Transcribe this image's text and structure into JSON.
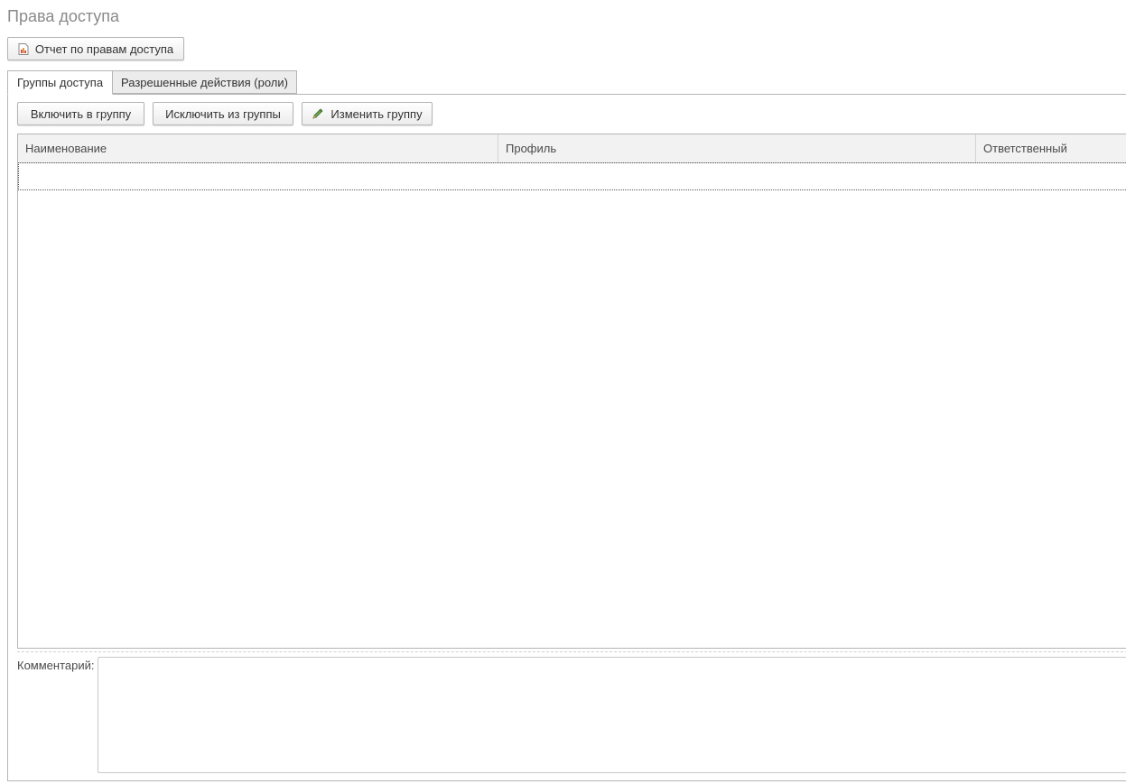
{
  "page": {
    "title": "Права доступа"
  },
  "toolbar": {
    "report_label": "Отчет по правам доступа",
    "report_icon": "report-icon"
  },
  "tabs": [
    {
      "label": "Группы доступа",
      "active": true
    },
    {
      "label": "Разрешенные действия (роли)",
      "active": false
    }
  ],
  "group_actions": {
    "include_label": "Включить в группу",
    "exclude_label": "Исключить из группы",
    "edit_label": "Изменить группу",
    "edit_icon": "pencil-icon"
  },
  "table": {
    "columns": [
      "Наименование",
      "Профиль",
      "Ответственный"
    ],
    "rows": []
  },
  "comment": {
    "label": "Комментарий:",
    "value": ""
  },
  "colors": {
    "border": "#b5b5b5",
    "title": "#8a8a8a",
    "header_bg": "#f2f2f2",
    "tab_inactive_bg": "#ececec"
  }
}
